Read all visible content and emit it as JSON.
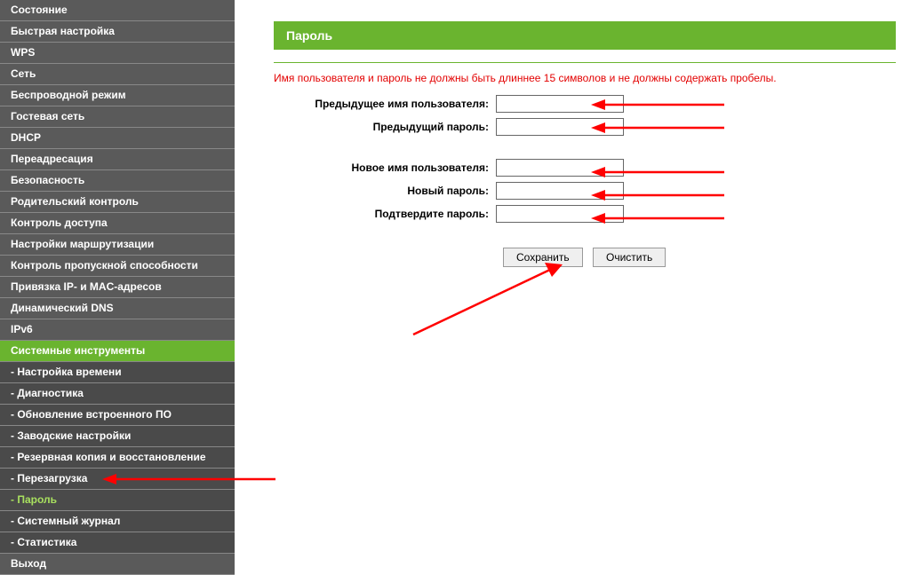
{
  "sidebar": {
    "items": [
      {
        "label": "Состояние",
        "type": "item"
      },
      {
        "label": "Быстрая настройка",
        "type": "item"
      },
      {
        "label": "WPS",
        "type": "item"
      },
      {
        "label": "Сеть",
        "type": "item"
      },
      {
        "label": "Беспроводной режим",
        "type": "item"
      },
      {
        "label": "Гостевая сеть",
        "type": "item"
      },
      {
        "label": "DHCP",
        "type": "item"
      },
      {
        "label": "Переадресация",
        "type": "item"
      },
      {
        "label": "Безопасность",
        "type": "item"
      },
      {
        "label": "Родительский контроль",
        "type": "item"
      },
      {
        "label": "Контроль доступа",
        "type": "item"
      },
      {
        "label": "Настройки маршрутизации",
        "type": "item"
      },
      {
        "label": "Контроль пропускной способности",
        "type": "item"
      },
      {
        "label": "Привязка IP- и MAC-адресов",
        "type": "item"
      },
      {
        "label": "Динамический DNS",
        "type": "item"
      },
      {
        "label": "IPv6",
        "type": "item"
      },
      {
        "label": "Системные инструменты",
        "type": "item",
        "active": true
      },
      {
        "label": "- Настройка времени",
        "type": "sub"
      },
      {
        "label": "- Диагностика",
        "type": "sub"
      },
      {
        "label": "- Обновление встроенного ПО",
        "type": "sub"
      },
      {
        "label": "- Заводские настройки",
        "type": "sub"
      },
      {
        "label": "- Резервная копия и восстановление",
        "type": "sub"
      },
      {
        "label": "- Перезагрузка",
        "type": "sub"
      },
      {
        "label": "- Пароль",
        "type": "sub",
        "active": true
      },
      {
        "label": "- Системный журнал",
        "type": "sub"
      },
      {
        "label": "- Статистика",
        "type": "sub"
      },
      {
        "label": "Выход",
        "type": "item"
      }
    ]
  },
  "page": {
    "title": "Пароль",
    "warning": "Имя пользователя и пароль не должны быть длиннее 15 символов и не должны содержать пробелы.",
    "labels": {
      "old_user": "Предыдущее имя пользователя:",
      "old_pass": "Предыдущий пароль:",
      "new_user": "Новое имя пользователя:",
      "new_pass": "Новый пароль:",
      "confirm_pass": "Подтвердите пароль:"
    },
    "buttons": {
      "save": "Сохранить",
      "clear": "Очистить"
    }
  }
}
